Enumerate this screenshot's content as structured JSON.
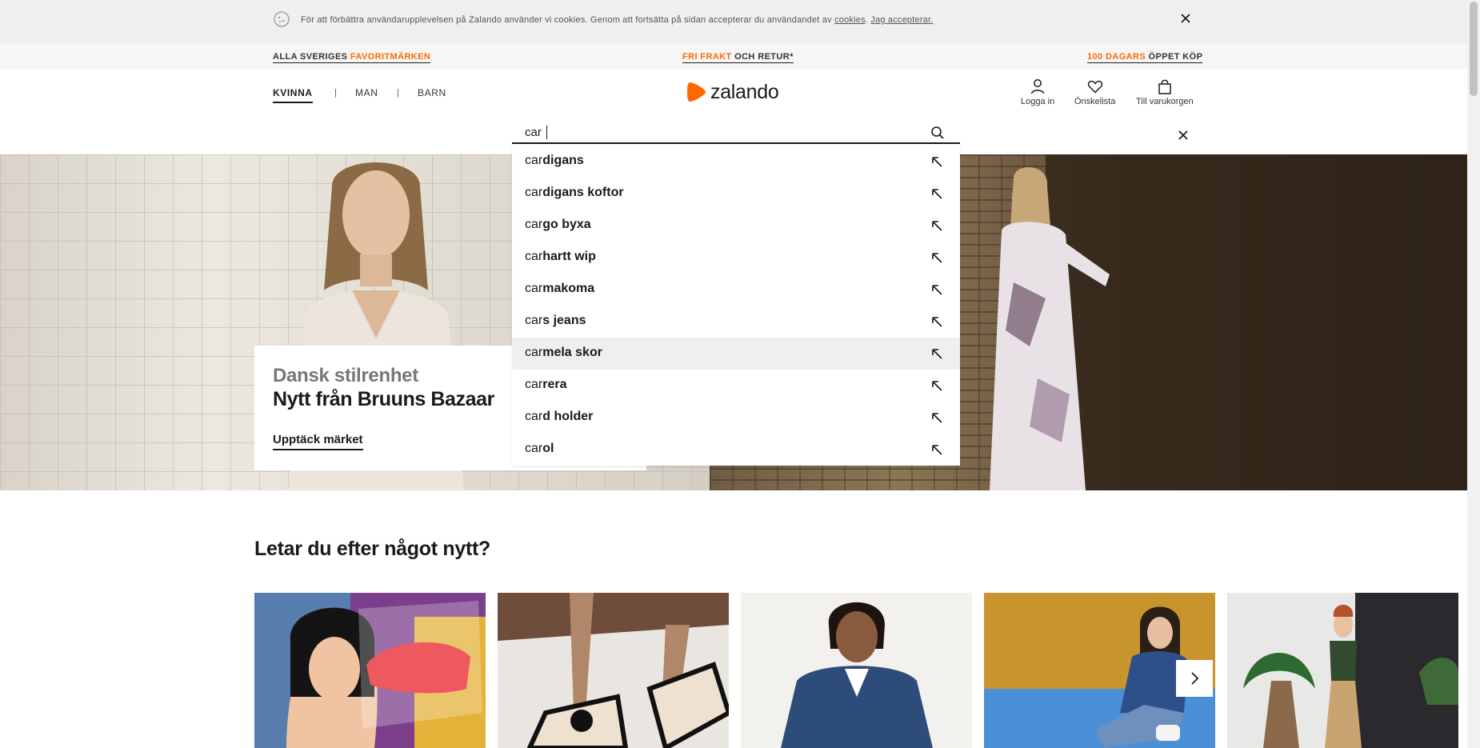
{
  "cookie_banner": {
    "text": "För att förbättra användarupplevelsen på Zalando använder vi cookies. Genom att fortsätta på sidan accepterar du användandet av",
    "cookies_link": "cookies",
    "accept_link": "Jag accepterar."
  },
  "promo": {
    "left_plain": "ALLA SVERIGES",
    "left_highlight": "FAVORITMÄRKEN",
    "center_highlight": "FRI FRAKT",
    "center_plain": "OCH RETUR*",
    "right_highlight": "100 DAGARS",
    "right_plain": "ÖPPET KÖP"
  },
  "nav": {
    "tabs": [
      "KVINNA",
      "MAN",
      "BARN"
    ],
    "separator": "|"
  },
  "logo": {
    "text": "zalando",
    "color": "#ff6900"
  },
  "header_actions": {
    "login": "Logga in",
    "wishlist": "Önskelista",
    "cart": "Till varukorgen"
  },
  "search": {
    "value": "car",
    "suggestions": [
      {
        "prefix": "car",
        "rest": "digans"
      },
      {
        "prefix": "car",
        "rest": "digans koftor"
      },
      {
        "prefix": "car",
        "rest": "go byxa"
      },
      {
        "prefix": "car",
        "rest": "hartt wip"
      },
      {
        "prefix": "car",
        "rest": "makoma"
      },
      {
        "prefix": "car",
        "rest": "s jeans"
      },
      {
        "prefix": "car",
        "rest": "mela skor"
      },
      {
        "prefix": "car",
        "rest": "rera"
      },
      {
        "prefix": "car",
        "rest": "d holder"
      },
      {
        "prefix": "car",
        "rest": "ol"
      }
    ]
  },
  "hero": {
    "subtitle": "Dansk stilrenhet",
    "title": "Nytt från Bruuns Bazaar",
    "link": "Upptäck märket"
  },
  "section": {
    "title": "Letar du efter något nytt?"
  },
  "colors": {
    "accent": "#ff6900",
    "text": "#1a1a1a"
  }
}
